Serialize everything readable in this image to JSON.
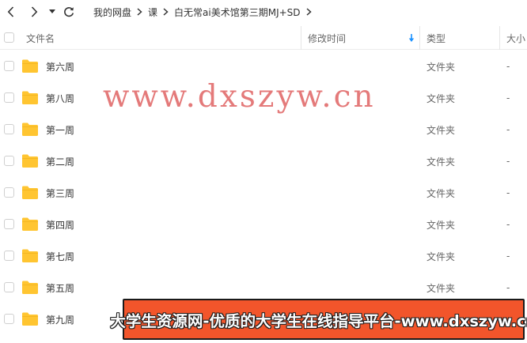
{
  "nav": {
    "back_icon": "chevron-left-icon",
    "forward_icon": "chevron-right-icon",
    "history_icon": "caret-down-icon",
    "refresh_icon": "refresh-icon"
  },
  "breadcrumb": [
    "我的网盘",
    "课",
    "白无常ai美术馆第三期MJ+SD"
  ],
  "columns": {
    "name": "文件名",
    "modified": "修改时间",
    "sort_icon": "sort-down-arrow-icon",
    "type": "类型",
    "size": "大小"
  },
  "files": [
    {
      "name": "第六周",
      "type": "文件夹",
      "size": "-"
    },
    {
      "name": "第八周",
      "type": "文件夹",
      "size": "-"
    },
    {
      "name": "第一周",
      "type": "文件夹",
      "size": "-"
    },
    {
      "name": "第二周",
      "type": "文件夹",
      "size": "-"
    },
    {
      "name": "第三周",
      "type": "文件夹",
      "size": "-"
    },
    {
      "name": "第四周",
      "type": "文件夹",
      "size": "-"
    },
    {
      "name": "第七周",
      "type": "文件夹",
      "size": "-"
    },
    {
      "name": "第五周",
      "type": "文件夹",
      "size": "-"
    },
    {
      "name": "第九周",
      "type": "文件夹",
      "size": "-"
    }
  ],
  "watermark": "www.dxszyw.cn",
  "banner": "大学生资源网-优质的大学生在线指导平台-www.dxszyw.cn",
  "colors": {
    "folder": "#ffc531",
    "accent_blue": "#1890ff",
    "watermark": "#dc5555",
    "banner_bg": "#f2552b"
  }
}
